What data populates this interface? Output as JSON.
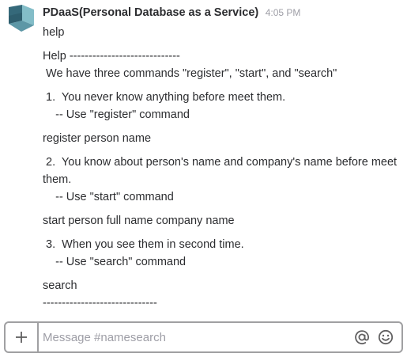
{
  "message": {
    "sender": "PDaaS(Personal Database as a Service)",
    "time": "4:05 PM",
    "avatar_icon": "app-logo-icon",
    "user_text": "help",
    "lines": {
      "header": "Help -----------------------------",
      "intro": " We have three commands \"register\", \"start\", and \"search\"",
      "item1": " 1.  You never know anything before meet them.",
      "item1_sub": "    -- Use \"register\" command",
      "register_usage": "register person name",
      "item2": " 2.  You know about person's name and company's name before meet them.",
      "item2_sub": "    -- Use \"start\" command",
      "start_usage": "start person full name company name",
      "item3": " 3.  When you see them in second time.",
      "item3_sub": "    -- Use \"search\" command",
      "search_usage": "search",
      "footer": "------------------------------"
    }
  },
  "composer": {
    "placeholder": "Message #namesearch",
    "plus_icon": "plus-icon",
    "at_icon": "at-mention-icon",
    "emoji_icon": "emoji-icon"
  },
  "colors": {
    "text": "#2c2d30",
    "muted": "#9e9ea6",
    "border": "#a0a0a2",
    "logo_dark": "#2e5e6e",
    "logo_light": "#7fb8c4"
  }
}
